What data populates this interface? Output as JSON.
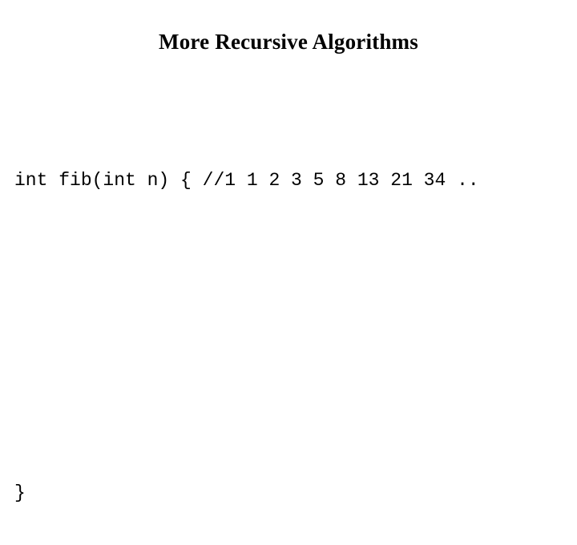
{
  "slide": {
    "background_color": "#ffffff",
    "text_color": "#000000",
    "title": "More Recursive Algorithms",
    "code": {
      "lines": [
        "int fib(int n) { //1 1 2 3 5 8 13 21 34 ..",
        "",
        "",
        "",
        "",
        "}"
      ],
      "line_1": "int fib(int n) { //1 1 2 3 5 8 13 21 34 ..",
      "line_2": "",
      "line_3": "",
      "line_4": "",
      "line_5": "",
      "line_6": "}"
    }
  }
}
